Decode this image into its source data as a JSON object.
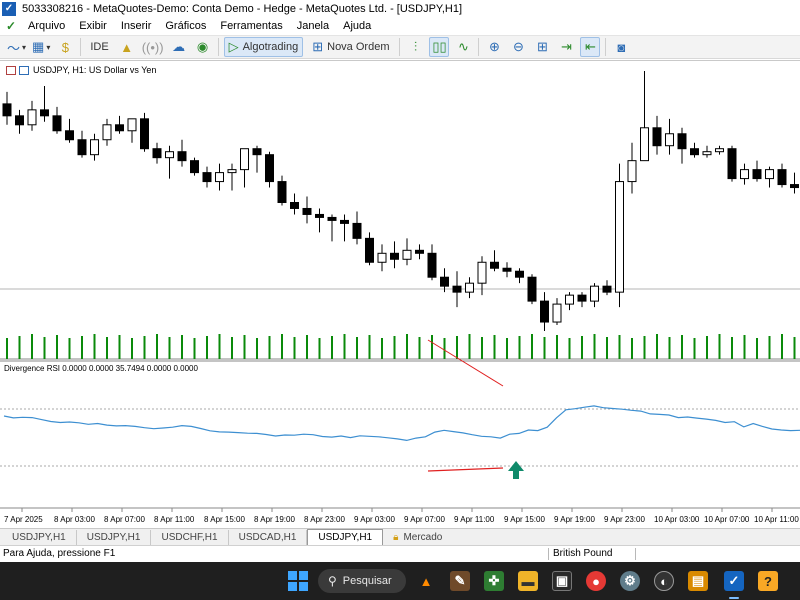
{
  "window": {
    "title": "5033308216 - MetaQuotes-Demo: Conta Demo - Hedge - MetaQuotes Ltd. - [USDJPY,H1]"
  },
  "menu": [
    "Arquivo",
    "Exibir",
    "Inserir",
    "Gráficos",
    "Ferramentas",
    "Janela",
    "Ajuda"
  ],
  "toolbar": {
    "ide_label": "IDE",
    "algotrading_label": "Algotrading",
    "nova_ordem_label": "Nova Ordem"
  },
  "chart": {
    "header": "USDJPY, H1:  US Dollar vs Yen",
    "indicator_header": "Divergence RSI 0.0000 0.0000 35.7494 0.0000 0.0000",
    "time_labels": [
      "7 Apr 2025",
      "8 Apr 03:00",
      "8 Apr 07:00",
      "8 Apr 11:00",
      "8 Apr 15:00",
      "8 Apr 19:00",
      "8 Apr 23:00",
      "9 Apr 03:00",
      "9 Apr 07:00",
      "9 Apr 11:00",
      "9 Apr 15:00",
      "9 Apr 19:00",
      "9 Apr 23:00",
      "10 Apr 03:00",
      "10 Apr 07:00",
      "10 Apr 11:00"
    ],
    "colors": {
      "bull": "#ffffff",
      "bear": "#000000",
      "volume": "#0a8a0a",
      "rsi": "#3d8fd1",
      "divergence": "#e02020",
      "arrow": "#0f8a6a"
    }
  },
  "chart_data": {
    "type": "candlestick",
    "symbol": "USDJPY",
    "timeframe": "H1",
    "candles": [
      {
        "o": 146.7,
        "h": 146.9,
        "l": 146.35,
        "c": 146.5
      },
      {
        "o": 146.5,
        "h": 146.6,
        "l": 146.2,
        "c": 146.35
      },
      {
        "o": 146.35,
        "h": 146.75,
        "l": 146.25,
        "c": 146.6
      },
      {
        "o": 146.6,
        "h": 147.0,
        "l": 146.4,
        "c": 146.5
      },
      {
        "o": 146.5,
        "h": 146.65,
        "l": 146.2,
        "c": 146.25
      },
      {
        "o": 146.25,
        "h": 146.45,
        "l": 146.05,
        "c": 146.1
      },
      {
        "o": 146.1,
        "h": 146.25,
        "l": 145.8,
        "c": 145.85
      },
      {
        "o": 145.85,
        "h": 146.2,
        "l": 145.75,
        "c": 146.1
      },
      {
        "o": 146.1,
        "h": 146.45,
        "l": 146.0,
        "c": 146.35
      },
      {
        "o": 146.35,
        "h": 146.5,
        "l": 146.2,
        "c": 146.25
      },
      {
        "o": 146.25,
        "h": 146.45,
        "l": 146.05,
        "c": 146.45
      },
      {
        "o": 146.45,
        "h": 146.55,
        "l": 145.9,
        "c": 145.95
      },
      {
        "o": 145.95,
        "h": 146.05,
        "l": 145.7,
        "c": 145.8
      },
      {
        "o": 145.8,
        "h": 146.0,
        "l": 145.45,
        "c": 145.9
      },
      {
        "o": 145.9,
        "h": 146.1,
        "l": 145.65,
        "c": 145.75
      },
      {
        "o": 145.75,
        "h": 145.8,
        "l": 145.5,
        "c": 145.55
      },
      {
        "o": 145.55,
        "h": 145.65,
        "l": 145.3,
        "c": 145.4
      },
      {
        "o": 145.4,
        "h": 145.7,
        "l": 145.25,
        "c": 145.55
      },
      {
        "o": 145.55,
        "h": 145.7,
        "l": 145.25,
        "c": 145.6
      },
      {
        "o": 145.6,
        "h": 145.95,
        "l": 145.3,
        "c": 145.95
      },
      {
        "o": 145.95,
        "h": 146.0,
        "l": 145.55,
        "c": 145.85
      },
      {
        "o": 145.85,
        "h": 145.9,
        "l": 145.3,
        "c": 145.4
      },
      {
        "o": 145.4,
        "h": 145.5,
        "l": 145.0,
        "c": 145.05
      },
      {
        "o": 145.05,
        "h": 145.2,
        "l": 144.85,
        "c": 144.95
      },
      {
        "o": 144.95,
        "h": 145.15,
        "l": 144.7,
        "c": 144.85
      },
      {
        "o": 144.85,
        "h": 144.95,
        "l": 144.55,
        "c": 144.8
      },
      {
        "o": 144.8,
        "h": 144.85,
        "l": 144.4,
        "c": 144.75
      },
      {
        "o": 144.75,
        "h": 144.85,
        "l": 144.4,
        "c": 144.7
      },
      {
        "o": 144.7,
        "h": 144.9,
        "l": 144.35,
        "c": 144.45
      },
      {
        "o": 144.45,
        "h": 144.55,
        "l": 144.0,
        "c": 144.05
      },
      {
        "o": 144.05,
        "h": 144.35,
        "l": 143.9,
        "c": 144.2
      },
      {
        "o": 144.2,
        "h": 144.4,
        "l": 143.95,
        "c": 144.1
      },
      {
        "o": 144.1,
        "h": 144.45,
        "l": 144.0,
        "c": 144.25
      },
      {
        "o": 144.25,
        "h": 144.35,
        "l": 144.1,
        "c": 144.2
      },
      {
        "o": 144.2,
        "h": 144.35,
        "l": 143.75,
        "c": 143.8
      },
      {
        "o": 143.8,
        "h": 143.95,
        "l": 143.55,
        "c": 143.65
      },
      {
        "o": 143.65,
        "h": 143.9,
        "l": 143.3,
        "c": 143.55
      },
      {
        "o": 143.55,
        "h": 143.8,
        "l": 143.45,
        "c": 143.7
      },
      {
        "o": 143.7,
        "h": 144.15,
        "l": 143.5,
        "c": 144.05
      },
      {
        "o": 144.05,
        "h": 144.25,
        "l": 143.9,
        "c": 143.95
      },
      {
        "o": 143.95,
        "h": 144.05,
        "l": 143.8,
        "c": 143.9
      },
      {
        "o": 143.9,
        "h": 143.95,
        "l": 143.7,
        "c": 143.8
      },
      {
        "o": 143.8,
        "h": 143.85,
        "l": 143.35,
        "c": 143.4
      },
      {
        "o": 143.4,
        "h": 143.55,
        "l": 142.9,
        "c": 143.05
      },
      {
        "o": 143.05,
        "h": 143.45,
        "l": 143.0,
        "c": 143.35
      },
      {
        "o": 143.35,
        "h": 143.55,
        "l": 143.25,
        "c": 143.5
      },
      {
        "o": 143.5,
        "h": 143.55,
        "l": 143.3,
        "c": 143.4
      },
      {
        "o": 143.4,
        "h": 143.7,
        "l": 143.3,
        "c": 143.65
      },
      {
        "o": 143.65,
        "h": 143.75,
        "l": 143.5,
        "c": 143.55
      },
      {
        "o": 143.55,
        "h": 145.7,
        "l": 143.3,
        "c": 145.4
      },
      {
        "o": 145.4,
        "h": 146.05,
        "l": 145.2,
        "c": 145.75
      },
      {
        "o": 145.75,
        "h": 147.25,
        "l": 145.8,
        "c": 146.3
      },
      {
        "o": 146.3,
        "h": 146.5,
        "l": 145.85,
        "c": 146.0
      },
      {
        "o": 146.0,
        "h": 146.45,
        "l": 145.85,
        "c": 146.2
      },
      {
        "o": 146.2,
        "h": 146.3,
        "l": 145.7,
        "c": 145.95
      },
      {
        "o": 145.95,
        "h": 146.05,
        "l": 145.8,
        "c": 145.85
      },
      {
        "o": 145.85,
        "h": 146.0,
        "l": 145.8,
        "c": 145.9
      },
      {
        "o": 145.9,
        "h": 146.0,
        "l": 145.85,
        "c": 145.95
      },
      {
        "o": 145.95,
        "h": 146.0,
        "l": 145.4,
        "c": 145.45
      },
      {
        "o": 145.45,
        "h": 145.7,
        "l": 145.35,
        "c": 145.6
      },
      {
        "o": 145.6,
        "h": 145.75,
        "l": 145.4,
        "c": 145.45
      },
      {
        "o": 145.45,
        "h": 145.65,
        "l": 145.3,
        "c": 145.6
      },
      {
        "o": 145.6,
        "h": 145.7,
        "l": 145.3,
        "c": 145.35
      },
      {
        "o": 145.35,
        "h": 145.55,
        "l": 145.2,
        "c": 145.3
      },
      {
        "o": 145.3,
        "h": 145.55,
        "l": 145.25,
        "c": 145.45
      },
      {
        "o": 145.45,
        "h": 145.55,
        "l": 145.35,
        "c": 145.4
      },
      {
        "o": 145.4,
        "h": 145.55,
        "l": 144.95,
        "c": 145.05
      },
      {
        "o": 145.05,
        "h": 145.15,
        "l": 144.85,
        "c": 144.9
      },
      {
        "o": 144.9,
        "h": 145.1,
        "l": 144.7,
        "c": 145.0
      },
      {
        "o": 145.0,
        "h": 145.15,
        "l": 144.7,
        "c": 144.85
      },
      {
        "o": 144.85,
        "h": 144.95,
        "l": 144.35,
        "c": 144.4
      },
      {
        "o": 144.4,
        "h": 144.6,
        "l": 144.3,
        "c": 144.55
      }
    ],
    "rsi": [
      42.0,
      40.5,
      41.0,
      40.8,
      39.2,
      37.8,
      37.0,
      37.4,
      36.8,
      35.6,
      36.2,
      35.0,
      34.4,
      34.6,
      34.0,
      33.0,
      32.2,
      32.8,
      33.4,
      34.6,
      34.0,
      32.4,
      30.6,
      29.8,
      29.6,
      29.2,
      28.8,
      28.6,
      27.8,
      26.6,
      27.4,
      27.2,
      28.0,
      27.6,
      26.2,
      25.8,
      26.6,
      25.4,
      26.8,
      26.4,
      26.0,
      25.2,
      24.4,
      23.2,
      25.0,
      26.0,
      29.6,
      31.0,
      30.0,
      29.0,
      27.6,
      26.4,
      26.0,
      25.0,
      28.0,
      28.6,
      31.2,
      30.8,
      33.4,
      40.6,
      46.8,
      47.6,
      48.8,
      49.8,
      48.4,
      47.8,
      47.2,
      46.4,
      45.8,
      43.6,
      43.2,
      42.8,
      40.8,
      41.2,
      40.4,
      39.6,
      38.6,
      37.0,
      37.6,
      33.6,
      36.2,
      34.0,
      32.0,
      31.2,
      30.8,
      31.0
    ],
    "rsi_levels": [
      30,
      70
    ],
    "volume_label": "Volume",
    "divergence": {
      "price_from": 21,
      "price_to": 47,
      "rsi_from": 43,
      "rsi_to": 56
    }
  },
  "tabs": [
    "USDJPY,H1",
    "USDJPY,H1",
    "USDCHF,H1",
    "USDCAD,H1",
    "USDJPY,H1",
    "Mercado"
  ],
  "active_tab": 4,
  "status": {
    "help": "Para Ajuda, pressione F1",
    "symbol": "British Pound"
  },
  "taskbar": {
    "search": "Pesquisar"
  }
}
